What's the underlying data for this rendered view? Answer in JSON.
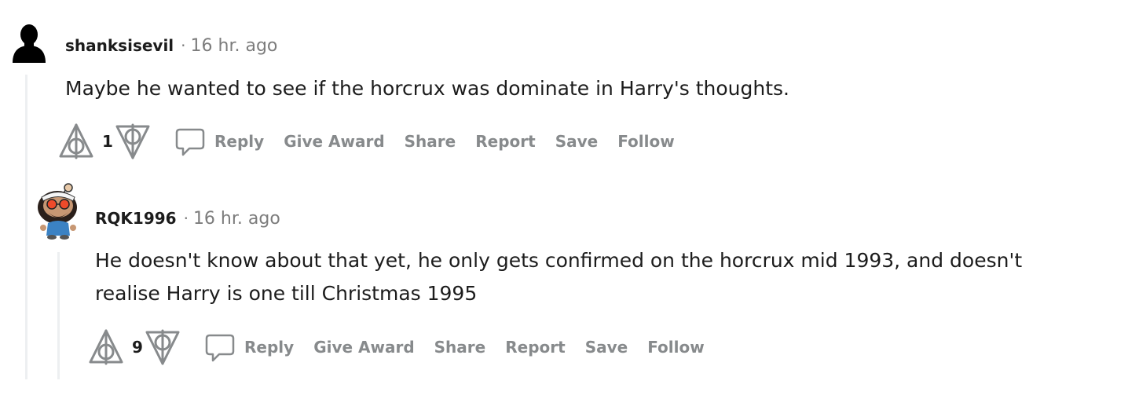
{
  "comments": [
    {
      "username": "shanksisevil",
      "separator": "·",
      "timestamp": "16 hr. ago",
      "avatar_icon": "user-silhouette-icon",
      "body": [
        "Maybe he wanted to see if the horcrux was dominate in Harry's thoughts."
      ],
      "vote_count": "1",
      "actions": {
        "reply": "Reply",
        "give_award": "Give Award",
        "share": "Share",
        "report": "Report",
        "save": "Save",
        "follow": "Follow"
      }
    },
    {
      "username": "RQK1996",
      "separator": "·",
      "timestamp": "16 hr. ago",
      "avatar_icon": "snoo-avatar-icon",
      "body": [
        "He doesn't know about that yet, he only gets confirmed on the horcrux mid 1993, and doesn't",
        "realise Harry is one till Christmas 1995"
      ],
      "vote_count": "9",
      "actions": {
        "reply": "Reply",
        "give_award": "Give Award",
        "share": "Share",
        "report": "Report",
        "save": "Save",
        "follow": "Follow"
      }
    }
  ],
  "colors": {
    "text_primary": "#1c1c1c",
    "text_secondary": "#7c7c7c",
    "action_text": "#878a8c",
    "thread_line": "#edeff1",
    "vote_icon": "#878a8c"
  }
}
